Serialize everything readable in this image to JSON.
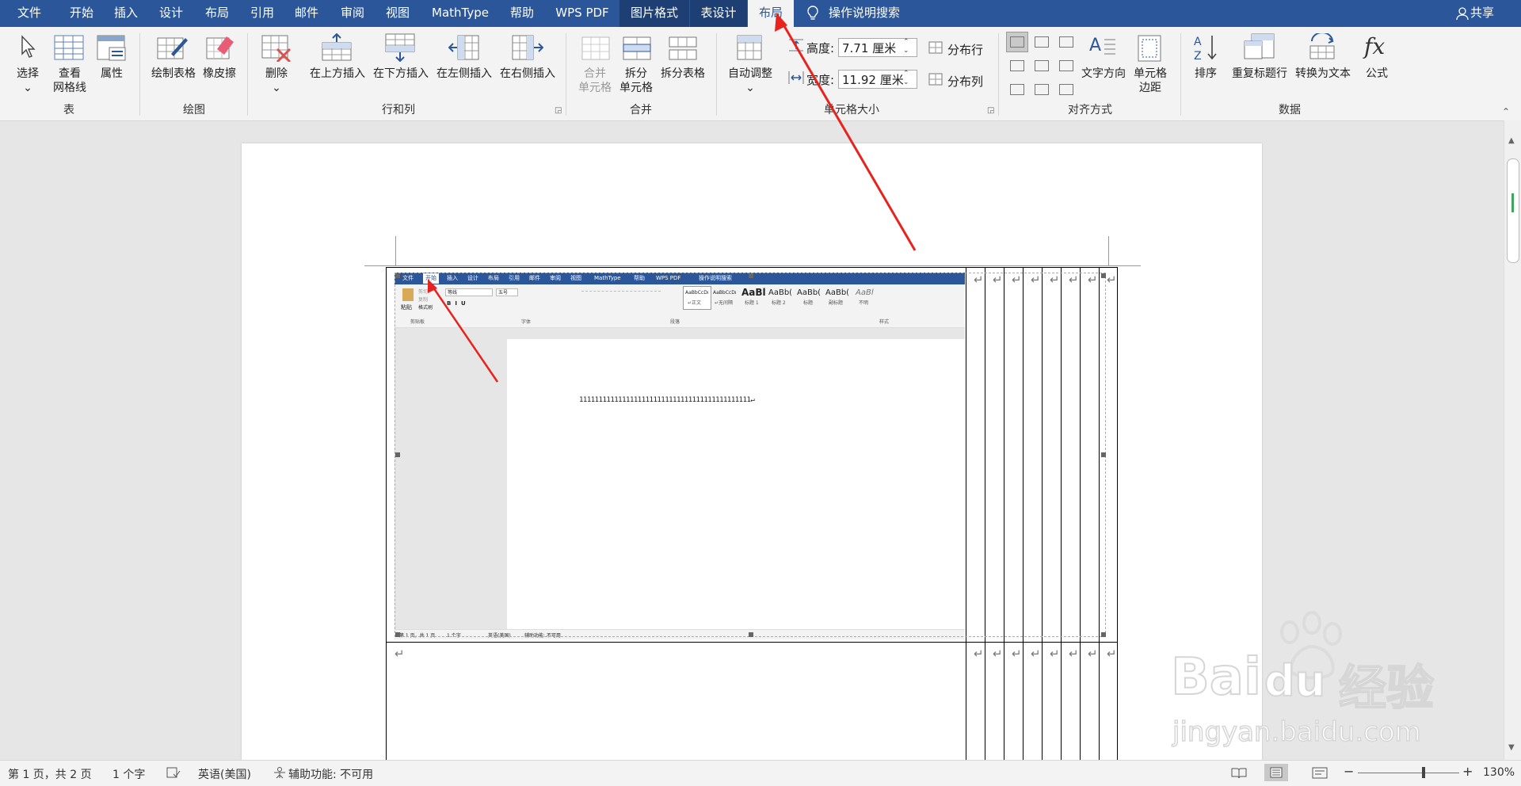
{
  "menubar": {
    "tabs": [
      {
        "label": "文件"
      },
      {
        "label": "开始"
      },
      {
        "label": "插入"
      },
      {
        "label": "设计"
      },
      {
        "label": "布局"
      },
      {
        "label": "引用"
      },
      {
        "label": "邮件"
      },
      {
        "label": "审阅"
      },
      {
        "label": "视图"
      },
      {
        "label": "MathType"
      },
      {
        "label": "帮助"
      },
      {
        "label": "WPS PDF"
      },
      {
        "label": "图片格式"
      },
      {
        "label": "表设计"
      },
      {
        "label": "布局"
      }
    ],
    "search_label": "操作说明搜索",
    "share_label": "共享"
  },
  "ribbon": {
    "table_group": {
      "select": "选择",
      "gridlines": "查看\n网格线",
      "properties": "属性",
      "label": "表"
    },
    "draw_group": {
      "draw_table": "绘制表格",
      "eraser": "橡皮擦",
      "label": "绘图"
    },
    "rowcol_group": {
      "delete": "删除",
      "insert_above": "在上方插入",
      "insert_below": "在下方插入",
      "insert_left": "在左侧插入",
      "insert_right": "在右侧插入",
      "label": "行和列"
    },
    "merge_group": {
      "merge_cells": "合并\n单元格",
      "split_cells": "拆分\n单元格",
      "split_table": "拆分表格",
      "label": "合并"
    },
    "cellsize_group": {
      "autofit": "自动调整",
      "height_label": "高度:",
      "height_value": "7.71 厘米",
      "width_label": "宽度:",
      "width_value": "11.92 厘米",
      "distribute_rows": "分布行",
      "distribute_cols": "分布列",
      "label": "单元格大小"
    },
    "align_group": {
      "text_direction": "文字方向",
      "cell_margins": "单元格\n边距",
      "label": "对齐方式"
    },
    "data_group": {
      "sort": "排序",
      "repeat_header": "重复标题行",
      "convert_text": "转换为文本",
      "formula": "公式",
      "label": "数据"
    }
  },
  "embedded": {
    "tabs": [
      "文件",
      "开始",
      "插入",
      "设计",
      "布局",
      "引用",
      "邮件",
      "审阅",
      "视图",
      "MathType",
      "帮助",
      "WPS PDF"
    ],
    "search": "操作说明搜索",
    "font_name": "等线",
    "font_size": "五号",
    "paste": "粘贴",
    "cut": "剪切",
    "copy": "复制",
    "format_painter": "格式刷",
    "groups": [
      "剪贴板",
      "字体",
      "段落",
      "样式"
    ],
    "styles": [
      {
        "preview": "AaBbCcDı",
        "name": "↵正文"
      },
      {
        "preview": "AaBbCcDı",
        "name": "↵无间隔"
      },
      {
        "preview": "AaBl",
        "name": "标题 1"
      },
      {
        "preview": "AaBb(",
        "name": "标题 2"
      },
      {
        "preview": "AaBb(",
        "name": "标题"
      },
      {
        "preview": "AaBb(",
        "name": "副标题"
      },
      {
        "preview": "AaBl",
        "name": "不明"
      }
    ],
    "doc_text": "11111111111111111111111111111111111111111111↵",
    "status": [
      "第 1 页，共 1 页",
      "1 个字",
      "英语(美国)",
      "辅助功能: 不可用"
    ]
  },
  "statusbar": {
    "page": "第 1 页，共 2 页",
    "words": "1 个字",
    "language": "英语(美国)",
    "accessibility": "辅助功能: 不可用",
    "zoom": "130%",
    "zoom_level": 0.65
  },
  "watermark": {
    "text1": "Bai",
    "text2": "du",
    "text3": "经验",
    "url": "jingyan.baidu.com"
  },
  "colors": {
    "accent": "#2b579a",
    "arrow": "#e8231e"
  }
}
